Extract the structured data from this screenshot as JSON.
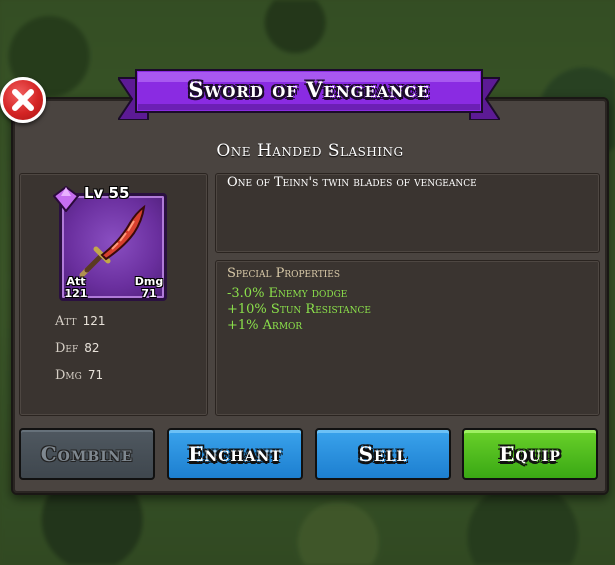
{
  "item": {
    "name": "Sword of Vengeance",
    "type": "One Handed Slashing",
    "level_label": "Lv 55",
    "description": "One of Teinn's twin blades of vengeance",
    "portrait_stats": {
      "att_label": "Att",
      "att_value": "121",
      "dmg_label": "Dmg",
      "dmg_value": "71"
    },
    "stats": [
      {
        "label": "Att",
        "value": "121"
      },
      {
        "label": "Def",
        "value": "82"
      },
      {
        "label": "Dmg",
        "value": "71"
      }
    ],
    "special_properties": {
      "title": "Special Properties",
      "items": [
        "-3.0% Enemy dodge",
        "+10% Stun Resistance",
        "+1% Armor"
      ]
    },
    "rarity_color": "#7a2fc4"
  },
  "actions": {
    "combine": "Combine",
    "enchant": "Enchant",
    "sell": "Sell",
    "equip": "Equip"
  },
  "icons": {
    "close": "close-icon",
    "gem": "gem-icon",
    "weapon": "sword-icon"
  },
  "colors": {
    "banner": "#8a2be2",
    "close": "#d42424",
    "enchant": "#1d7fd0",
    "sell": "#1d7fd0",
    "equip": "#3aa814",
    "combine_disabled": "#4a525a",
    "property_text": "#8be14b"
  }
}
